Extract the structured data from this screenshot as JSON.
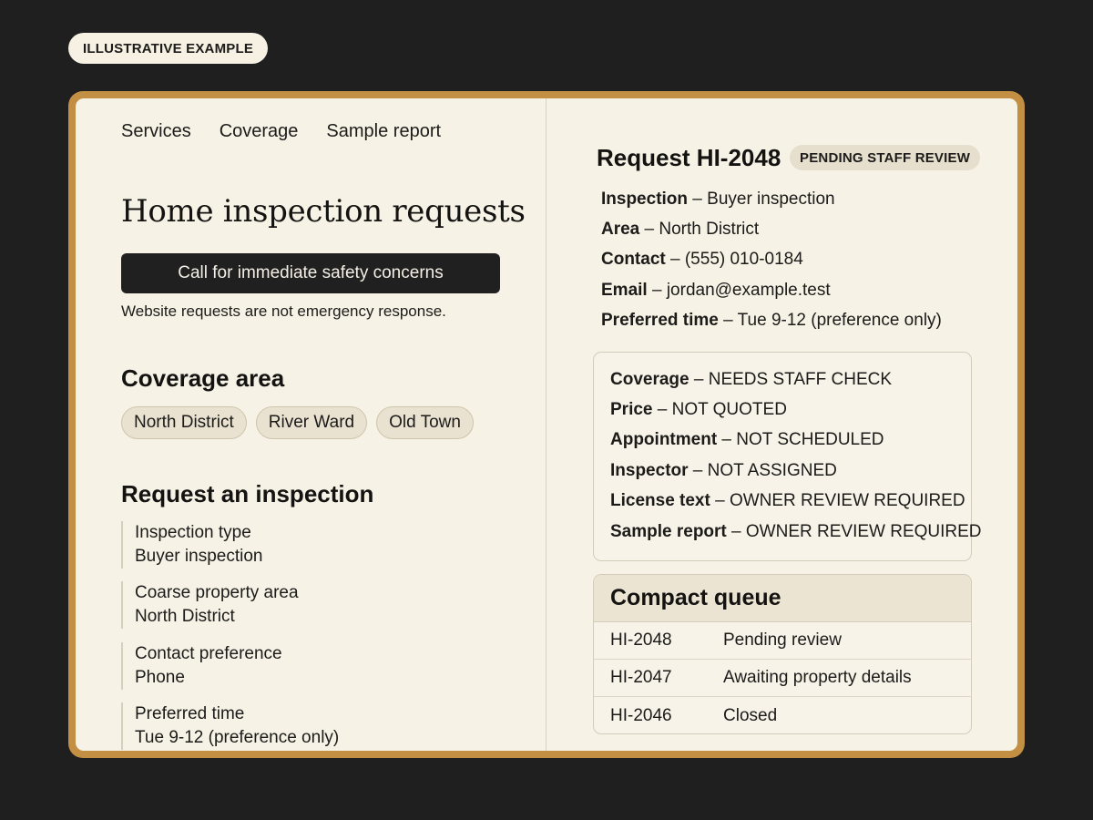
{
  "badge": "ILLUSTRATIVE EXAMPLE",
  "nav": [
    "Services",
    "Coverage",
    "Sample report"
  ],
  "page_title": "Home inspection requests",
  "emergency": {
    "button_label": "Call for immediate safety concerns",
    "note": "Website requests are not emergency response."
  },
  "coverage": {
    "heading": "Coverage area",
    "areas": [
      "North District",
      "River Ward",
      "Old Town"
    ]
  },
  "request_form": {
    "heading": "Request an inspection",
    "fields": [
      {
        "label": "Inspection type",
        "value": "Buyer inspection"
      },
      {
        "label": "Coarse property area",
        "value": "North District"
      },
      {
        "label": "Contact preference",
        "value": "Phone"
      },
      {
        "label": "Preferred time",
        "value": "Tue 9-12 (preference only)"
      }
    ]
  },
  "request": {
    "title": "Request HI-2048",
    "status": "PENDING STAFF REVIEW",
    "details": [
      {
        "key": "Inspection",
        "value": " – Buyer inspection"
      },
      {
        "key": "Area",
        "value": " – North District"
      },
      {
        "key": "Contact",
        "value": " – (555) 010-0184"
      },
      {
        "key": "Email",
        "value": " – jordan@example.test"
      },
      {
        "key": "Preferred time",
        "value": " – Tue 9-12 (preference only)"
      }
    ],
    "statuses": [
      {
        "key": "Coverage",
        "value": " – NEEDS STAFF CHECK"
      },
      {
        "key": "Price",
        "value": " – NOT QUOTED"
      },
      {
        "key": "Appointment",
        "value": " – NOT SCHEDULED"
      },
      {
        "key": "Inspector",
        "value": " – NOT ASSIGNED"
      },
      {
        "key": "License text",
        "value": " – OWNER REVIEW REQUIRED"
      },
      {
        "key": "Sample report",
        "value": " – OWNER REVIEW REQUIRED"
      }
    ]
  },
  "queue": {
    "heading": "Compact queue",
    "rows": [
      {
        "id": "HI-2048",
        "status": "Pending review"
      },
      {
        "id": "HI-2047",
        "status": "Awaiting property details"
      },
      {
        "id": "HI-2046",
        "status": "Closed"
      }
    ]
  },
  "colors": {
    "background": "#1f1f20",
    "frame": "#c38f43",
    "panel": "#f6f2e6",
    "button": "#202021"
  }
}
